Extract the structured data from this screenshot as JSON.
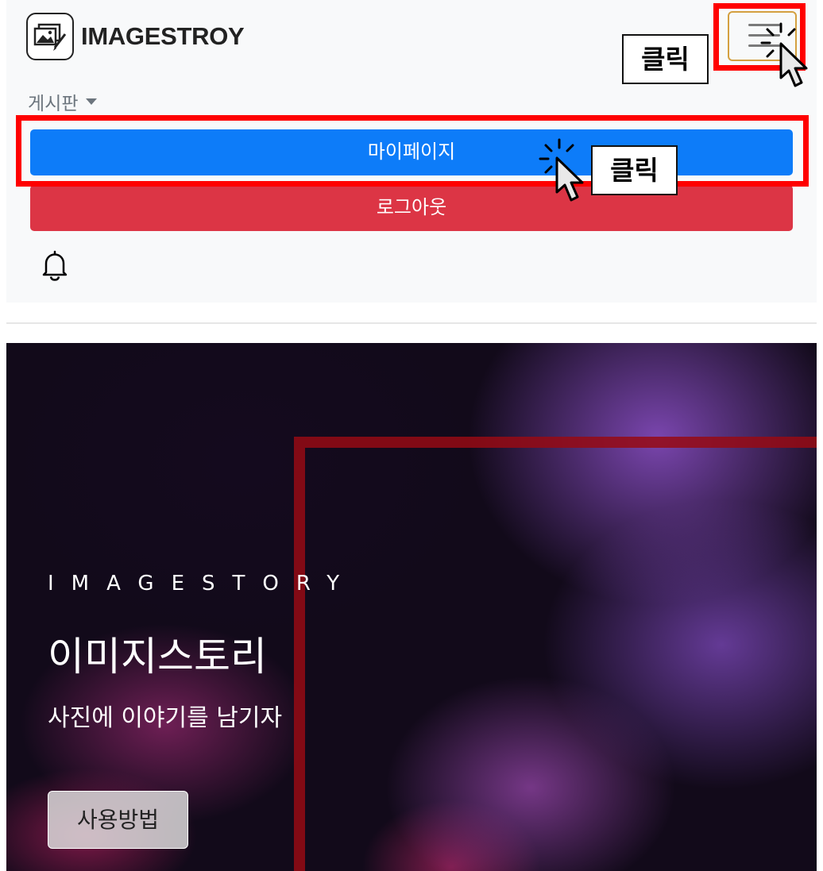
{
  "header": {
    "brand_name": "IMAGESTROY",
    "brand_icon": "gallery-edit-icon",
    "menu_icon": "hamburger-icon"
  },
  "menu": {
    "dropdown_label": "게시판",
    "mypage_label": "마이페이지",
    "logout_label": "로그아웃",
    "notification_icon": "bell-icon"
  },
  "hero": {
    "eyebrow": "IMAGESTORY",
    "title": "이미지스토리",
    "subtitle": "사진에 이야기를 남기자",
    "button_label": "사용방법"
  },
  "annotations": {
    "callout_1": "클릭",
    "callout_2": "클릭",
    "highlight_color": "#ff0000"
  },
  "colors": {
    "primary": "#0d7cf9",
    "danger": "#dc3545",
    "navbar_bg": "#f8f9fa"
  }
}
